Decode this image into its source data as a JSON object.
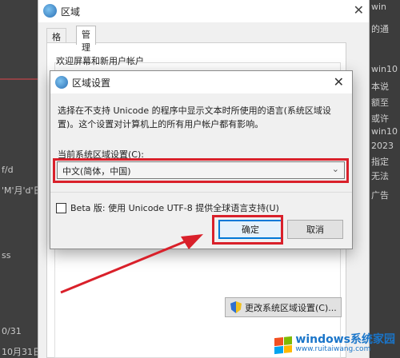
{
  "background": {
    "left_fragments": [
      "f/d",
      "'M'月'd'日",
      "ss",
      "0/31",
      "10月31日"
    ],
    "right_fragments": [
      "win",
      "的通",
      "win10",
      "本说",
      "额至",
      "或许",
      "win10",
      "2023",
      "指定",
      "无法",
      "广告"
    ]
  },
  "parent_dialog": {
    "title": "区域",
    "close_glyph": "✕",
    "tabs": [
      "格式",
      "管理"
    ],
    "active_tab": "管理",
    "group_title": "欢迎屏幕和新用户帐户",
    "change_button_label": "更改系统区域设置(C)..."
  },
  "modal": {
    "title": "区域设置",
    "close_glyph": "✕",
    "description": "选择在不支持 Unicode 的程序中显示文本时所使用的语言(系统区域设置)。这个设置对计算机上的所有用户帐户都有影响。",
    "current_locale_label": "当前系统区域设置(C):",
    "current_locale_value": "中文(简体，中国)",
    "beta_checkbox_label": "Beta 版: 使用 Unicode UTF-8 提供全球语言支持(U)",
    "beta_checked": false,
    "ok_label": "确定",
    "cancel_label": "取消"
  },
  "annotations": {
    "highlight_color": "#d9202a"
  },
  "watermark": {
    "text": "windows系统家园",
    "url": "www.ruitaiwang.com"
  }
}
